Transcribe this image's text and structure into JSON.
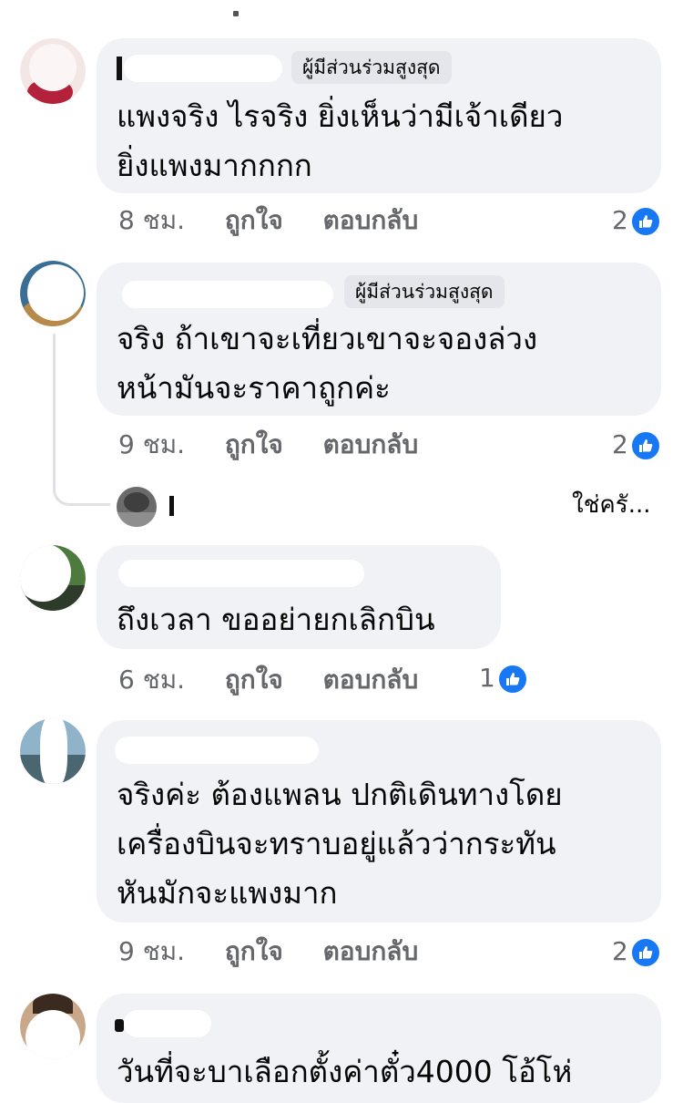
{
  "comments": [
    {
      "badge": "ผู้มีส่วนร่วมสูงสุด",
      "text_lines": [
        "แพงจริง ไรจริง ยิ่งเห็นว่ามีเจ้าเดียว",
        "ยิ่งแพงมากกกก"
      ],
      "time": "8 ชม.",
      "like": "ถูกใจ",
      "reply": "ตอบกลับ",
      "reaction_count": "2",
      "reaction_icon": "like-icon"
    },
    {
      "badge": "ผู้มีส่วนร่วมสูงสุด",
      "text_lines": [
        "จริง  ถ้าเขาจะเที่ยวเขาจะจองล่วง",
        "หน้ามันจะราคาถูกค่ะ"
      ],
      "time": "9 ชม.",
      "like": "ถูกใจ",
      "reply": "ตอบกลับ",
      "reaction_count": "2",
      "reaction_icon": "like-icon",
      "reply_preview": "ใช่ครั..."
    },
    {
      "text_lines": [
        "ถึงเวลา ขออย่ายกเลิกบิน"
      ],
      "time": "6 ชม.",
      "like": "ถูกใจ",
      "reply": "ตอบกลับ",
      "reaction_count": "1",
      "reaction_icon": "like-icon"
    },
    {
      "text_lines": [
        "จริงค่ะ ต้องแพลน ปกติเดินทางโดย",
        "เครื่องบินจะทราบอยู่แล้วว่ากระทัน",
        "หันมักจะแพงมาก"
      ],
      "time": "9 ชม.",
      "like": "ถูกใจ",
      "reply": "ตอบกลับ",
      "reaction_count": "2",
      "reaction_icon": "like-icon"
    },
    {
      "text_lines": [
        "วันที่จะบาเลือกตั้งค่าตั๋ว4000 โอ้โห่"
      ]
    }
  ],
  "colors": {
    "bubble": "#f0f2f5",
    "meta_text": "#65676b",
    "like_blue": "#1877f2",
    "badge_bg": "#e4e6eb"
  }
}
